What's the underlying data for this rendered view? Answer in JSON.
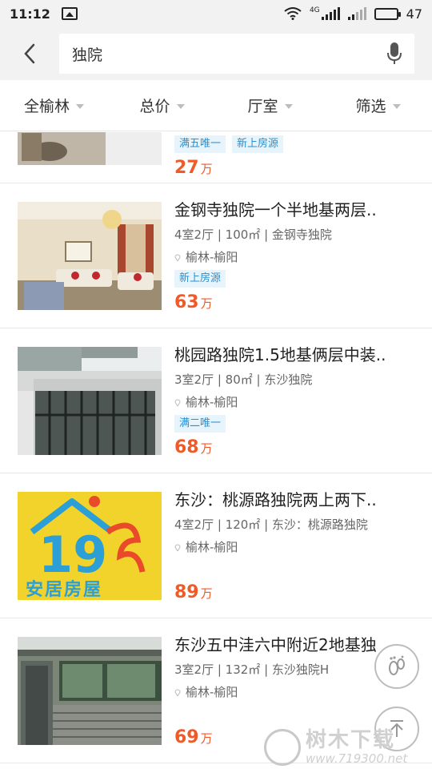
{
  "status": {
    "time": "11:12",
    "battery": "47",
    "network": "4G"
  },
  "search": {
    "query": "独院"
  },
  "filters": [
    {
      "label": "全榆林"
    },
    {
      "label": "总价"
    },
    {
      "label": "厅室"
    },
    {
      "label": "筛选"
    }
  ],
  "partial_item": {
    "tags": [
      "满五唯一",
      "新上房源"
    ],
    "price": "27",
    "unit": "万"
  },
  "listings": [
    {
      "title": "金钢寺独院一个半地基两层..",
      "meta": "4室2厅 | 100㎡ | 金钢寺独院",
      "location": "榆林-榆阳",
      "tags": [
        "新上房源"
      ],
      "price": "63",
      "unit": "万"
    },
    {
      "title": "桃园路独院1.5地基俩层中装..",
      "meta": "3室2厅 | 80㎡ | 东沙独院",
      "location": "榆林-榆阳",
      "tags": [
        "满二唯一"
      ],
      "price": "68",
      "unit": "万"
    },
    {
      "title": "东沙：桃源路独院两上两下..",
      "meta": "4室2厅 | 120㎡ | 东沙：桃源路独院",
      "location": "榆林-榆阳",
      "tags": [],
      "price": "89",
      "unit": "万"
    },
    {
      "title": "东沙五中洼六中附近2地基独",
      "meta": "3室2厅 | 132㎡ | 东沙独院H",
      "location": "榆林-榆阳",
      "tags": [],
      "price": "69",
      "unit": "万"
    }
  ],
  "thumb_sign": {
    "text": "安居房屋"
  },
  "watermark": {
    "text": "树木下载",
    "url": "www.719300.net"
  },
  "icons": [
    "back-arrow-icon",
    "microphone-icon",
    "footprint-icon",
    "scroll-top-icon",
    "location-pin-icon"
  ],
  "colors": {
    "price": "#f05a28",
    "tag_text": "#2b8fd2",
    "tag_bg": "#e8f4fb"
  }
}
